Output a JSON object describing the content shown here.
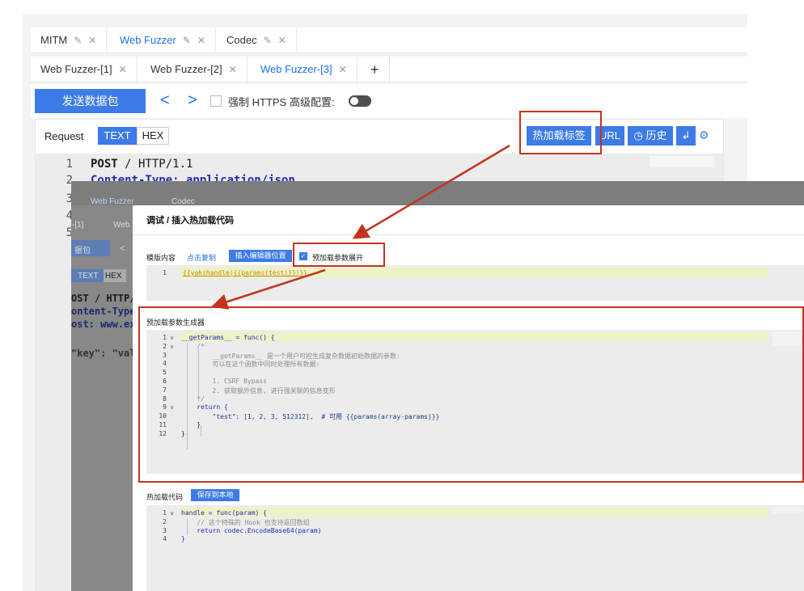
{
  "top_tabs": [
    {
      "label": "MITM"
    },
    {
      "label": "Web Fuzzer"
    },
    {
      "label": "Codec"
    }
  ],
  "sub_tabs": [
    {
      "label": "Web Fuzzer-[1]"
    },
    {
      "label": "Web Fuzzer-[2]"
    },
    {
      "label": "Web Fuzzer-[3]"
    },
    {
      "label": "+"
    }
  ],
  "toolbar": {
    "send_label": "发送数据包",
    "prev_label": "<",
    "next_label": ">",
    "https_label": "强制 HTTPS",
    "advanced_label": "高级配置:"
  },
  "request": {
    "label": "Request",
    "text_btn": "TEXT",
    "hex_btn": "HEX",
    "hotpatch_btn": "热加载标签",
    "url_btn": "URL",
    "history_btn": "历史",
    "history_icon": "clock-icon",
    "lines": [
      {
        "num": "1",
        "text": "POST / HTTP/1.1"
      },
      {
        "num": "2",
        "text": "Content-Type: application/json"
      },
      {
        "num": "3",
        "text": ""
      },
      {
        "num": "4",
        "text": ""
      },
      {
        "num": "5",
        "text": ""
      }
    ]
  },
  "backdrop": {
    "tab1": "Web Fuzzer",
    "tab2": "Codec",
    "sub1": "-[1]",
    "sub2": "Web F",
    "send": "据包",
    "prev": "<",
    "text_btn": "TEXT",
    "hex_btn": "HEX",
    "line1": "OST / HTTP/",
    "line2": "ontent-Type",
    "line3": "ost: www.ex",
    "line4": "\"key\": \"val"
  },
  "modal": {
    "title": "调试 / 插入热加载代码",
    "template_label": "模版内容",
    "copy_link": "点击复制",
    "insert_btn": "插入编辑器位置",
    "expand_label": "预加载参数展开",
    "template_code": {
      "num": "1",
      "text": "{{yak(handle|{{params(test)}})}}"
    },
    "generator_title": "预加载参数生成器",
    "generator_lines": [
      {
        "num": "1",
        "text": "__getParams__ = func() {"
      },
      {
        "num": "2",
        "text": "    /*"
      },
      {
        "num": "3",
        "text": "        __getParams__ 是一个用户可控生成复杂数据初始数据的参数:"
      },
      {
        "num": "4",
        "text": "        可以在这个函数中同时处理所有数据:"
      },
      {
        "num": "5",
        "text": ""
      },
      {
        "num": "6",
        "text": "        1. CSRF Bypass"
      },
      {
        "num": "7",
        "text": "        2. 获取额外信息, 进行强关联的信息变形"
      },
      {
        "num": "8",
        "text": "    */"
      },
      {
        "num": "9",
        "text": "    return {"
      },
      {
        "num": "10",
        "text": "        \"test\": [1, 2, 3, 512312],  # 可用 {{params(array-params)}}"
      },
      {
        "num": "11",
        "text": "    }"
      },
      {
        "num": "12",
        "text": "}"
      }
    ],
    "hotload_title": "热加载代码",
    "save_btn": "保存到本地",
    "hotload_lines": [
      {
        "num": "1",
        "text": "handle = func(param) {"
      },
      {
        "num": "2",
        "text": "    // 这个特殊的 Hook 也支持返回数组"
      },
      {
        "num": "3",
        "text": "    return codec.EncodeBase64(param)"
      },
      {
        "num": "4",
        "text": "}"
      }
    ]
  },
  "colors": {
    "accent": "#3d7be6",
    "annotation_red": "#c2341f",
    "keyword": "#1e2bb8",
    "comment": "#8a8a8a"
  }
}
